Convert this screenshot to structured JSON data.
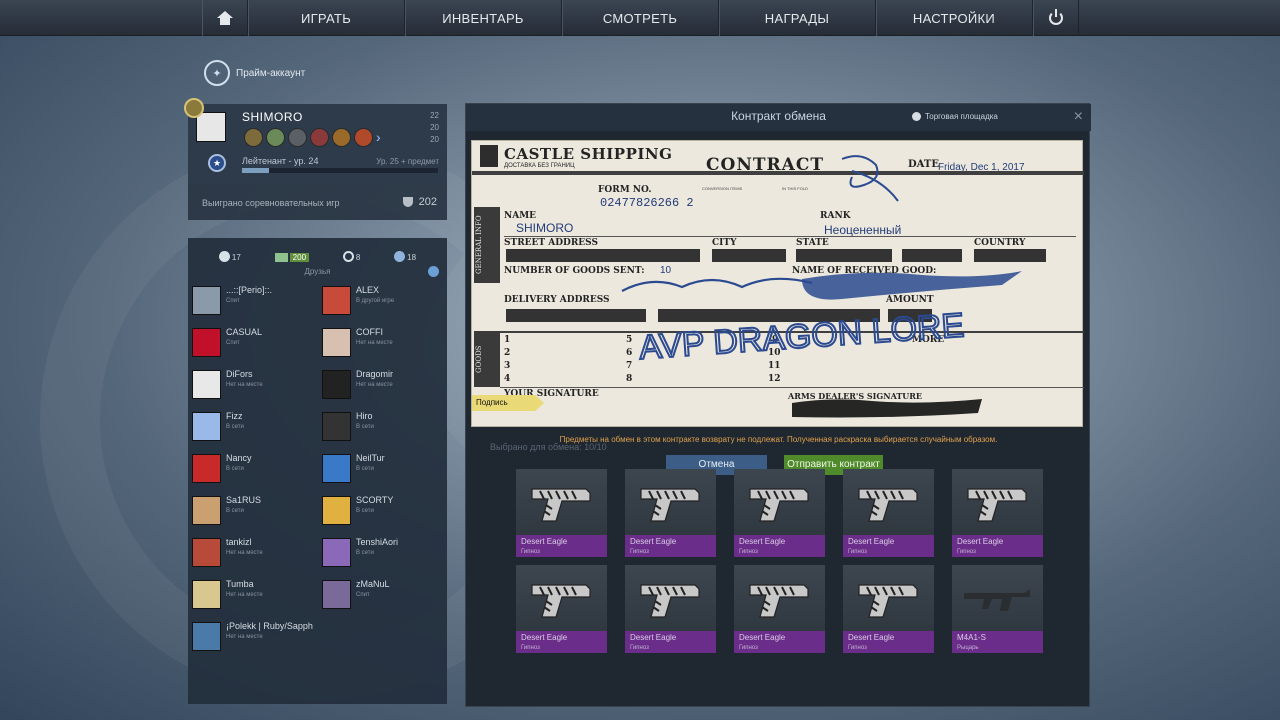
{
  "nav": {
    "items": [
      "ИГРАТЬ",
      "ИНВЕНТАРЬ",
      "СМОТРЕТЬ",
      "НАГРАДЫ",
      "НАСТРОЙКИ"
    ],
    "home_icon": "home-icon",
    "power_icon": "power-icon"
  },
  "prime": {
    "label": "Прайм-аккаунт"
  },
  "profile": {
    "name": "SHIMORO",
    "rank": "Лейтенант - ур. 24",
    "next": "Ур. 25 + предмет",
    "xp_fraction": 0.14,
    "wins_label": "Выиграно соревновательных игр",
    "wins": "202",
    "mini_stats": [
      "22",
      "20",
      "20"
    ]
  },
  "friends": {
    "tabs": {
      "friends": "17",
      "messages": "200",
      "recent": "8",
      "groups": "18"
    },
    "title": "Друзья",
    "list": [
      {
        "name": "...::[Perio]::.",
        "status": "Спит"
      },
      {
        "name": "ALEX",
        "status": "В другой игре"
      },
      {
        "name": "CASUAL",
        "status": "Спит"
      },
      {
        "name": "COFFI",
        "status": "Нет на месте"
      },
      {
        "name": "DiFors",
        "status": "Нет на месте"
      },
      {
        "name": "Dragomir",
        "status": "Нет на месте"
      },
      {
        "name": "Fizz",
        "status": "В сети"
      },
      {
        "name": "Hiro",
        "status": "В сети"
      },
      {
        "name": "Nancy",
        "status": "В сети"
      },
      {
        "name": "NeilTur",
        "status": "В сети"
      },
      {
        "name": "Sa1RUS",
        "status": "В сети"
      },
      {
        "name": "SCORTY",
        "status": "В сети"
      },
      {
        "name": "tankizl",
        "status": "Нет на месте"
      },
      {
        "name": "TenshiAori",
        "status": "В сети"
      },
      {
        "name": "Tumba",
        "status": "Нет на месте"
      },
      {
        "name": "zMaNuL",
        "status": "Спит"
      },
      {
        "name": "¡Polekk | Ruby/Sapph",
        "status": "Нет на месте"
      }
    ]
  },
  "contract": {
    "title": "Контракт обмена",
    "market": "Торговая площадка",
    "close": "×",
    "company": "CASTLE SHIPPING",
    "company_sub": "ДОСТАВКА БЕЗ ГРАНИЦ",
    "heading": "CONTRACT",
    "date_label": "DATE",
    "date": "Friday, Dec 1, 2017",
    "form_label": "FORM NO.",
    "form_no": "02477826266 2",
    "general_info": "GENERAL INFO",
    "goods": "GOODS",
    "name_label": "NAME",
    "name": "SHIMORO",
    "rank_label": "RANK",
    "rank": "Неоцененный",
    "street": "STREET ADDRESS",
    "city": "CITY",
    "state": "STATE",
    "country": "COUNTRY",
    "goods_sent": "NUMBER OF GOODS SENT:",
    "goods_count": "10",
    "receiver": "NAME OF RECEIVED GOOD:",
    "delivery": "DELIVERY ADDRESS",
    "amount": "AMOUNT",
    "more": "MORE",
    "numbers": [
      "1",
      "2",
      "3",
      "4",
      "5",
      "6",
      "7",
      "8",
      "9",
      "10",
      "11",
      "12"
    ],
    "your_sig": "YOUR SIGNATURE",
    "dealer_sig": "ARMS DEALER'S SIGNATURE",
    "sign_button": "Подпись",
    "handwriting": "AVP DRAGON LORE",
    "warning": "Предметы на обмен в этом контракте возврату не подлежат. Полученная раскраска выбирается случайным образом.",
    "selected": "Выбрано для обмена: 10/10",
    "cancel": "Отмена",
    "send": "Отправить контракт"
  },
  "items": [
    {
      "name": "Desert Eagle",
      "rarity": "Гипноз"
    },
    {
      "name": "Desert Eagle",
      "rarity": "Гипноз"
    },
    {
      "name": "Desert Eagle",
      "rarity": "Гипноз"
    },
    {
      "name": "Desert Eagle",
      "rarity": "Гипноз"
    },
    {
      "name": "Desert Eagle",
      "rarity": "Гипноз"
    },
    {
      "name": "Desert Eagle",
      "rarity": "Гипноз"
    },
    {
      "name": "Desert Eagle",
      "rarity": "Гипноз"
    },
    {
      "name": "Desert Eagle",
      "rarity": "Гипноз"
    },
    {
      "name": "Desert Eagle",
      "rarity": "Гипноз"
    },
    {
      "name": "M4A1-S",
      "rarity": "Рыцарь"
    }
  ],
  "colors": {
    "accent": "#4f8a2b",
    "rarity_purple": "#6a2d8a",
    "ink": "#233c78"
  }
}
